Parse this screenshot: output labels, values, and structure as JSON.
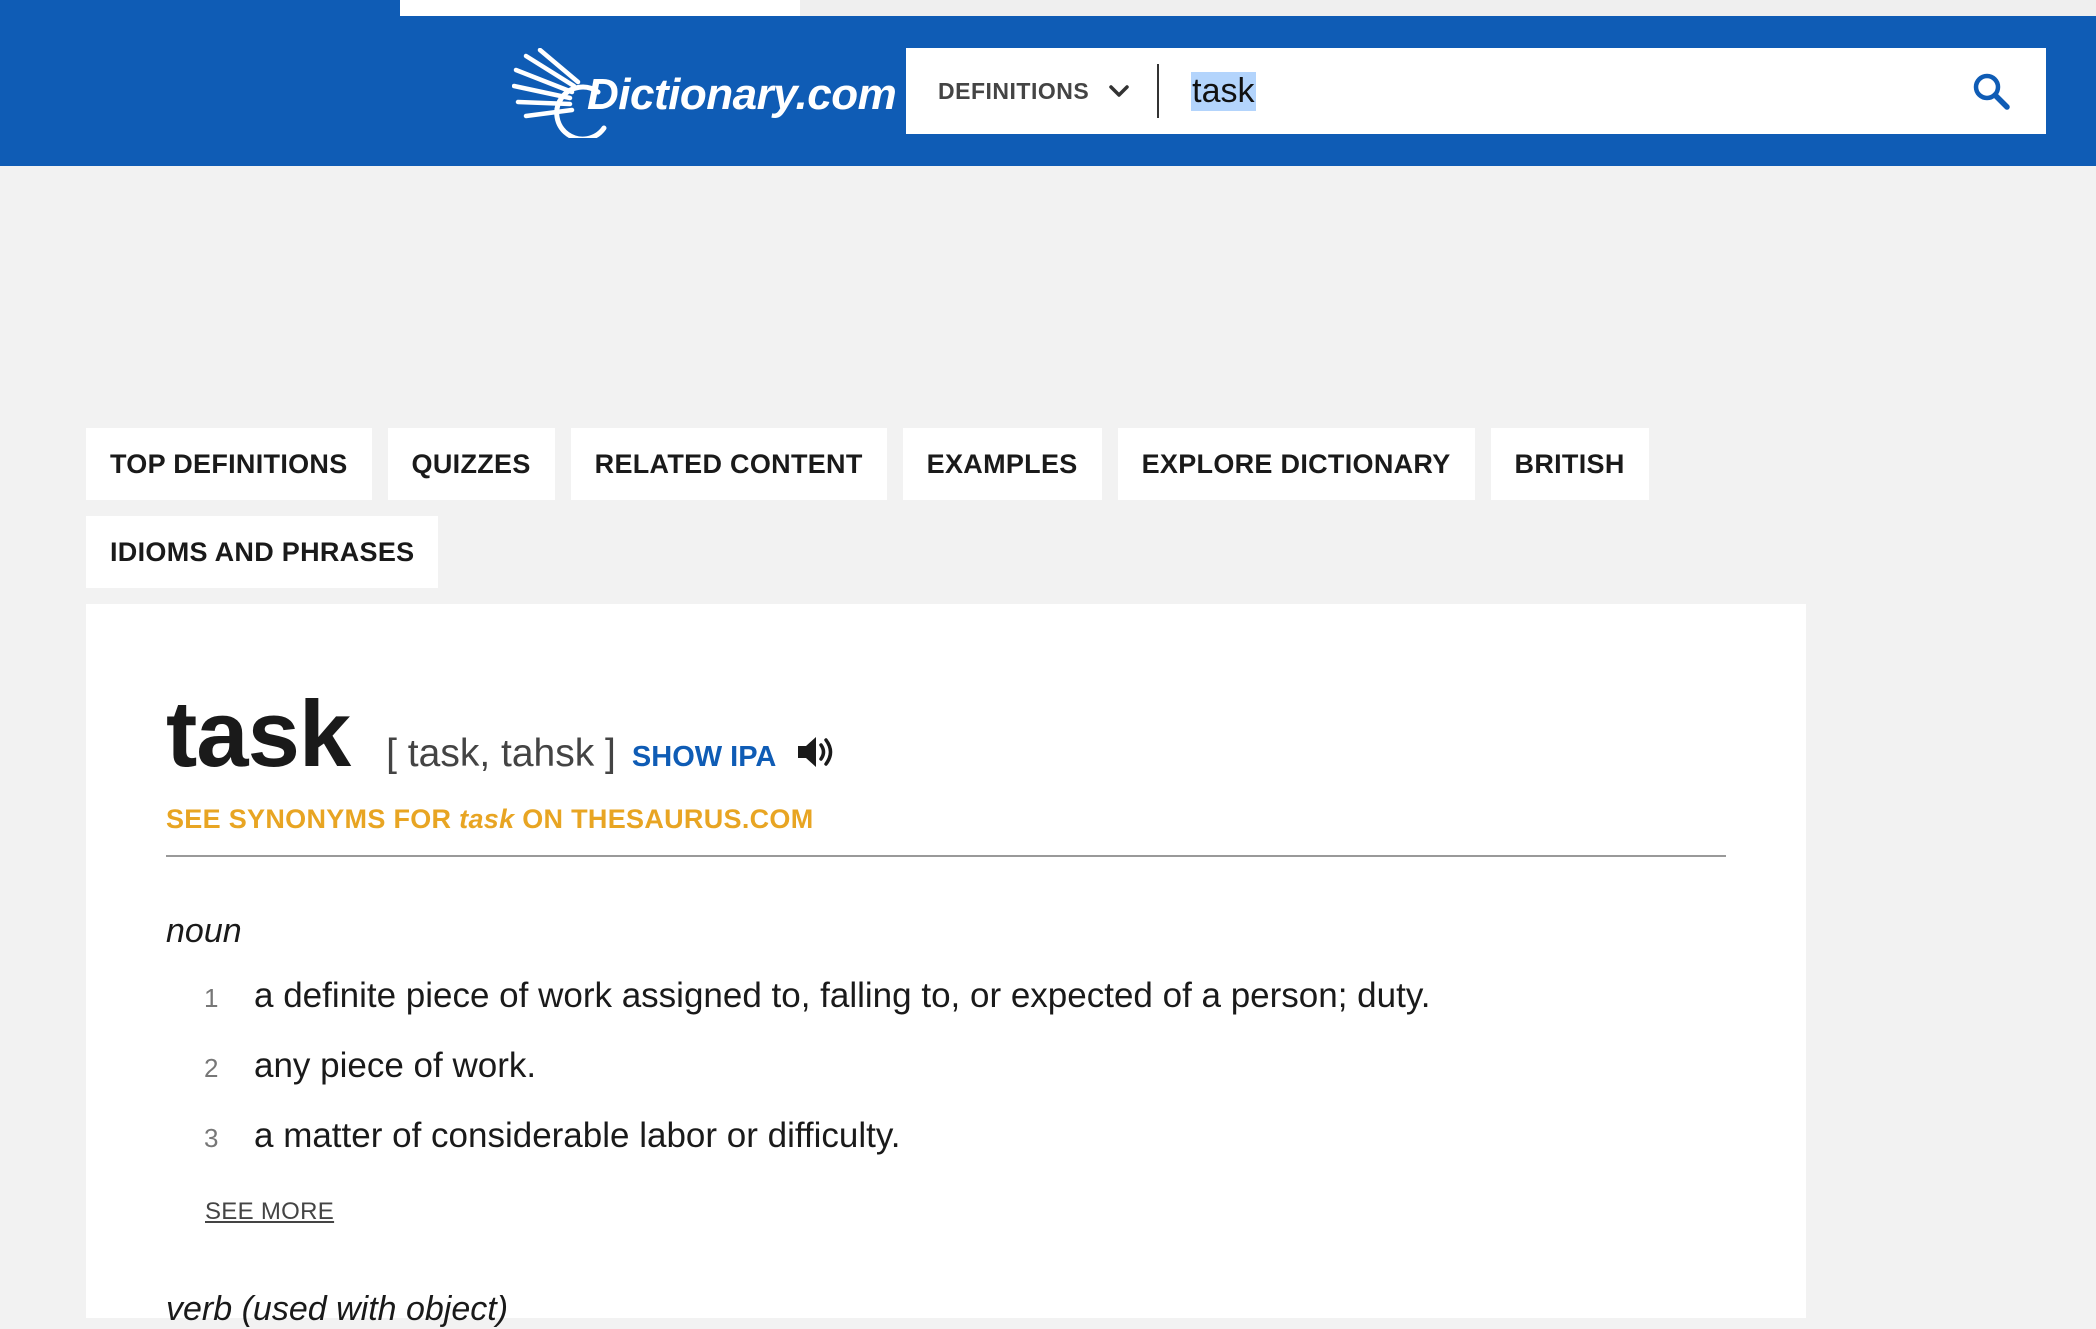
{
  "header": {
    "logo_text": "Dictionary.com",
    "search_type_label": "DEFINITIONS",
    "search_value": "task"
  },
  "nav": {
    "tabs": [
      {
        "label": "TOP DEFINITIONS"
      },
      {
        "label": "QUIZZES"
      },
      {
        "label": "RELATED CONTENT"
      },
      {
        "label": "EXAMPLES"
      },
      {
        "label": "EXPLORE DICTIONARY"
      },
      {
        "label": "BRITISH"
      },
      {
        "label": "IDIOMS AND PHRASES"
      }
    ]
  },
  "entry": {
    "headword": "task",
    "pronunciation": "[ task, tahsk ]",
    "show_ipa_label": "SHOW IPA",
    "synonyms_prefix": "SEE SYNONYMS FOR ",
    "synonyms_word": "task",
    "synonyms_suffix": " ON THESAURUS.COM",
    "part_of_speech": "noun",
    "definitions": [
      {
        "num": "1",
        "text": "a definite piece of work assigned to, falling to, or expected of a person; duty."
      },
      {
        "num": "2",
        "text": "any piece of work."
      },
      {
        "num": "3",
        "text": "a matter of considerable labor or difficulty."
      }
    ],
    "see_more_label": "SEE MORE",
    "part_of_speech_2": "verb (used with object)"
  },
  "colors": {
    "brand_blue": "#0f5cb5",
    "synonyms_orange": "#e8a523",
    "page_bg": "#f2f2f2"
  },
  "icons": {
    "logo": "sunburst-logo-icon",
    "dropdown": "chevron-down-icon",
    "search": "search-icon",
    "audio": "speaker-icon"
  }
}
